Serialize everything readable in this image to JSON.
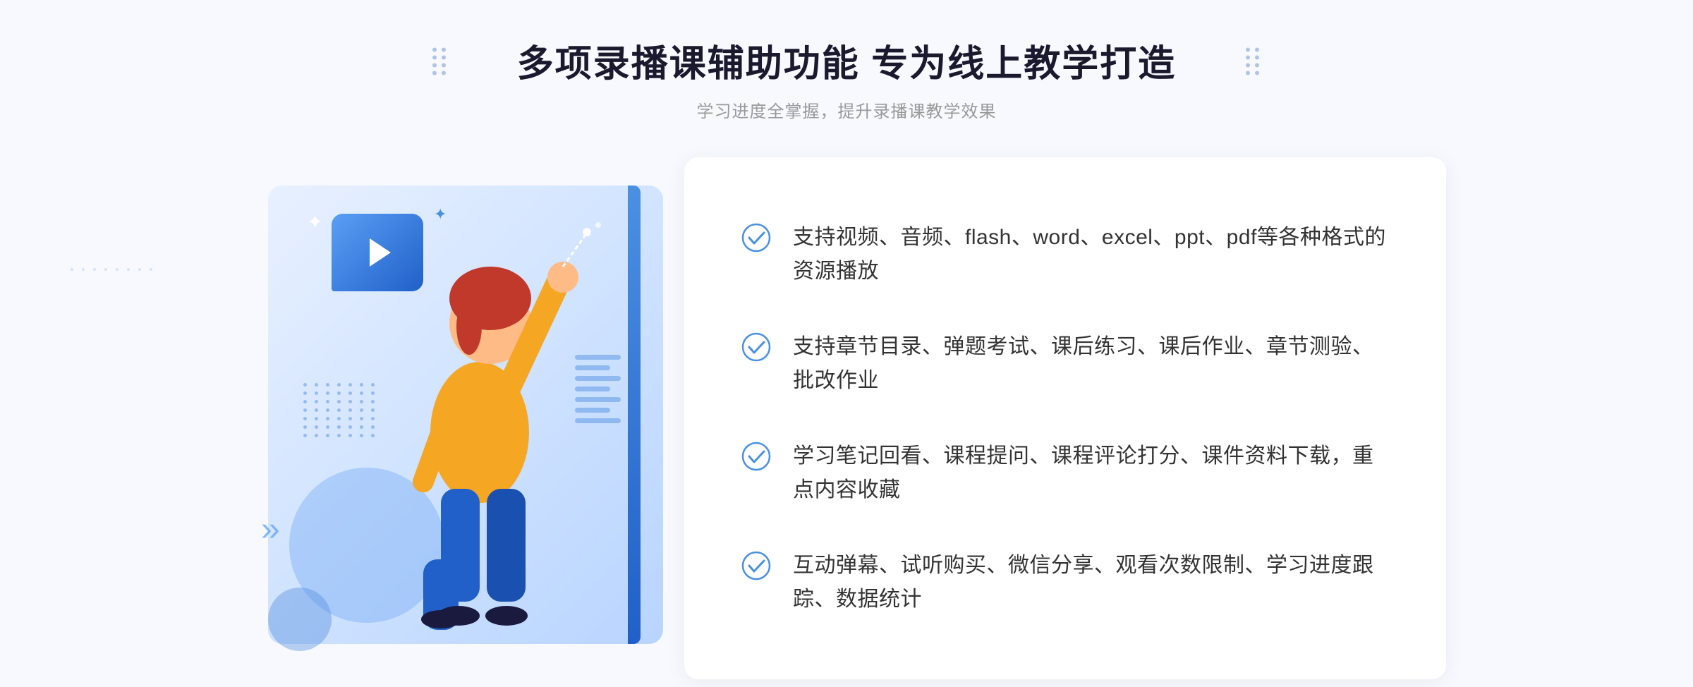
{
  "header": {
    "title": "多项录播课辅助功能 专为线上教学打造",
    "subtitle": "学习进度全掌握，提升录播课教学效果"
  },
  "features": [
    {
      "id": "feature-1",
      "text": "支持视频、音频、flash、word、excel、ppt、pdf等各种格式的资源播放"
    },
    {
      "id": "feature-2",
      "text": "支持章节目录、弹题考试、课后练习、课后作业、章节测验、批改作业"
    },
    {
      "id": "feature-3",
      "text": "学习笔记回看、课程提问、课程评论打分、课件资料下载，重点内容收藏"
    },
    {
      "id": "feature-4",
      "text": "互动弹幕、试听购买、微信分享、观看次数限制、学习进度跟踪、数据统计"
    }
  ],
  "decorations": {
    "chevron_left": "»",
    "sparkle": "✦"
  }
}
